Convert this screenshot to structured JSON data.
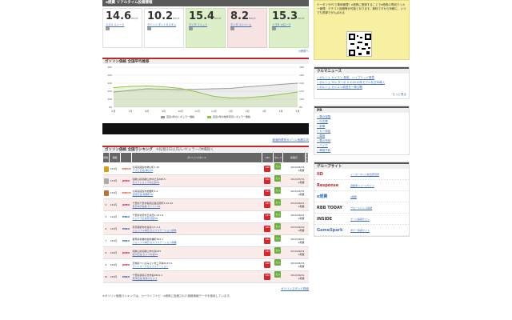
{
  "realtime": {
    "title": "e燃費 リアルタイム投稿情報",
    "unit": "km/L",
    "cards": [
      {
        "value": "14.6",
        "link": "スズキ ルシード",
        "user": "",
        "style": "plain"
      },
      {
        "value": "10.2",
        "link": "ダイハツ タントカスタム",
        "user": "",
        "style": "plain"
      },
      {
        "value": "15.4",
        "link": "ホンダ フィット",
        "user": "",
        "style": "green"
      },
      {
        "value": "8.2",
        "link": "ホンダ ストリーム",
        "user": "",
        "style": "pink"
      },
      {
        "value": "15.3",
        "link": "トヨタ カローラ",
        "user": "",
        "style": "green"
      }
    ],
    "more": "e燃費へ"
  },
  "chart_section": {
    "title": "ガソリン価格 全国平均推移",
    "legend": [
      "直近1年のレギュラー価格",
      "直近1年の前年同月レギュラー価格"
    ],
    "link": "都道府県別ガソリン価格平均"
  },
  "chart_data": {
    "type": "line",
    "title": "",
    "x": [
      "6月",
      "7月",
      "8月",
      "9月",
      "10月",
      "11月",
      "12月",
      "1月",
      "2月",
      "3月",
      "4月",
      "5月"
    ],
    "series": [
      {
        "name": "直近1年のレギュラー価格",
        "values": [
          118,
          122,
          126,
          125,
          124,
          125,
          126,
          127,
          131,
          134,
          137,
          140
        ],
        "color": "#9a9a9a"
      },
      {
        "name": "直近1年の前年同月レギュラー価格",
        "values": [
          129,
          132,
          133,
          131,
          127,
          118,
          107,
          103,
          104,
          107,
          112,
          118
        ],
        "color": "#8cc63f"
      }
    ],
    "yticks": [
      "180",
      "160",
      "140",
      "120",
      "100",
      "80"
    ],
    "ylim": [
      80,
      180
    ],
    "grid": true,
    "legend_position": "bottom"
  },
  "ranking": {
    "title": "ガソリン価格 全国ランキング",
    "subtitle": "※投稿3日以内/レギュラー/沖縄除く",
    "headers": [
      "順位",
      "価格",
      "",
      "ガソリンスタンド",
      "24h",
      "セルフ",
      "投稿日",
      "投稿者"
    ],
    "rows": [
      {
        "rank": "1",
        "price": "123円",
        "brand": "ENEOS",
        "brand_color": "#e94e1b",
        "addr": "北海道函館市神山町7-20",
        "name": "アサヒ石油 神山SS",
        "date": "2010/05/31",
        "user": "e燃費",
        "medal": "#d4a017"
      },
      {
        "rank": "2",
        "price": "123円",
        "brand": "JOMO",
        "brand_color": "#d6001c",
        "addr": "和歌山県和歌山市中之島388-5",
        "name": "セルフショップ中之島SS",
        "date": "2010/05/31",
        "user": "e燃費",
        "medal": "#aaaaaa"
      },
      {
        "rank": "3",
        "price": "123円",
        "brand": "ENEOS",
        "brand_color": "#e94e1b",
        "addr": "北海道函館市桔梗町3-2",
        "name": "道南石油 桔梗町SS",
        "date": "2010/05/31",
        "user": "e燃費",
        "medal": "#b87333"
      },
      {
        "rank": "4",
        "price": "124円",
        "brand": "JOMO",
        "brand_color": "#d6001c",
        "addr": "千葉県千葉市稲毛区長沼原町5-24-20",
        "name": "東日本宇佐美 ガソリンSS",
        "date": "2010/06/01",
        "user": "e燃費",
        "medal": ""
      },
      {
        "rank": "5",
        "price": "124円",
        "brand": "ESSO",
        "brand_color": "#004a98",
        "addr": "千葉県市原市五井西1-237-8",
        "name": "カジウラ五井西 国道SS",
        "date": "2010/06/01",
        "user": "e燃費",
        "medal": ""
      },
      {
        "rank": "6",
        "price": "125円",
        "brand": "ESSO",
        "brand_color": "#004a98",
        "addr": "東京都調布市多摩川7-3-4",
        "name": "ジョイフル本田 セルフステーション調布",
        "date": "2010/06/02",
        "user": "e燃費",
        "medal": ""
      },
      {
        "rank": "7",
        "price": "125円",
        "brand": "ESSO",
        "brand_color": "#004a98",
        "addr": "群馬県前橋市新前橋町556-1",
        "name": "ジョイフル本田 セルフステーション前橋",
        "date": "2010/06/01",
        "user": "e燃費",
        "medal": ""
      },
      {
        "rank": "8",
        "price": "126円",
        "brand": "JOMO",
        "brand_color": "#d6001c",
        "addr": "和歌山県和歌山市中島635",
        "name": "紀州石油 セルフ中島SS",
        "date": "2010/06/01",
        "user": "e燃費",
        "medal": ""
      },
      {
        "rank": "9",
        "price": "126円",
        "brand": "JOMO",
        "brand_color": "#d6001c",
        "addr": "茨城県つくばみらい市上平柳1915-5",
        "name": "ランドマークセルフステーション",
        "date": "2010/05/31",
        "user": "e燃費",
        "medal": ""
      },
      {
        "rank": "10",
        "price": "126円",
        "brand": "ESSO",
        "brand_color": "#004a98",
        "addr": "千葉県我孫子市布佐2804-1",
        "name": "東洋石油 我孫子セルフ",
        "date": "2010/06/01",
        "user": "e燃費",
        "medal": ""
      }
    ],
    "h24_label": "24h",
    "self_label": "セルフ",
    "more": "ガソリンスタンド検索",
    "footnote": "※ガソリン価格ランキングは、カーライフナビ・e燃費に投稿された価格情報データを使用しています。"
  },
  "sidebar": {
    "ad_text": "ケータイやPCで車両管理！e燃費に登録することでe燃費の専用マイカー管理、クチコミ投稿等が可能となります。無料ですから気軽に、いつでも簡単でがんばれる",
    "news_title": "クルマニュース",
    "news": [
      "ポルシェ カイエン 新型、ハイブリッド発表",
      "ポルシェ 911 ターボ S の2010年モデルを日本導入",
      "ポルシェ カイエン新型を一挙公開"
    ],
    "news_more": "もっと見る",
    "pr_title": "PR",
    "pr_items": [
      "車の保険",
      "中古車",
      "新車",
      "カー用品",
      "車検",
      "車の売却",
      "バイク",
      "車検予約"
    ],
    "group_title": "グループサイト",
    "groups": [
      {
        "logo": "IID",
        "desc": "インターネット総合研究所",
        "color": "#c0272d"
      },
      {
        "logo": "Response",
        "desc": "自動車ニュースサイト",
        "color": "#c0272d"
      },
      {
        "logo": "e燃費",
        "desc": "e燃費",
        "color": "#3a7cc0"
      },
      {
        "logo": "RBB TODAY",
        "desc": "ブロードバンド情報",
        "color": "#333333"
      },
      {
        "logo": "INSIDE",
        "desc": "ゲーム情報サイト",
        "color": "#333333"
      },
      {
        "logo": "GameSpark",
        "desc": "洋ゲー情報サイト",
        "color": "#4a6fb5"
      }
    ]
  }
}
